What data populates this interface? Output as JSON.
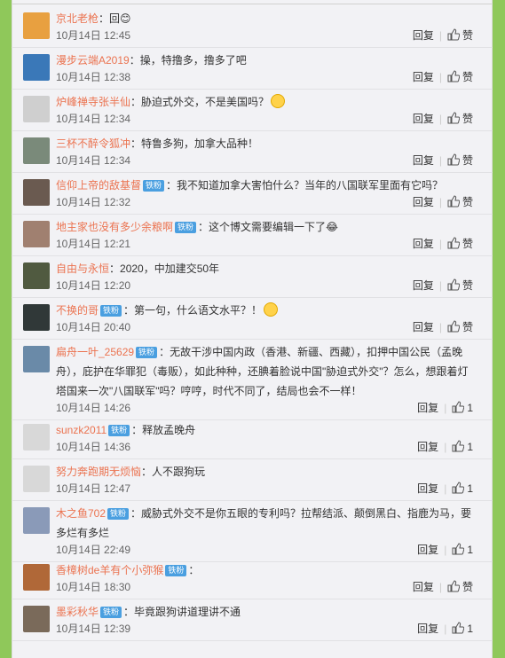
{
  "labels": {
    "reply": "回复",
    "like": "赞"
  },
  "comments": [
    {
      "user": "京北老枪",
      "badge": "",
      "text": "：回😊",
      "date": "10月14日 12:45",
      "likes": "",
      "avatar_color": "#e8a040"
    },
    {
      "user": "漫步云端A2019",
      "badge": "",
      "text": "：操，特撸多，撸多了吧",
      "date": "10月14日 12:38",
      "likes": "",
      "avatar_color": "#3a78b8"
    },
    {
      "user": "炉峰禅寺张半仙",
      "badge": "",
      "text": "：胁迫式外交，不是美国吗？",
      "date": "10月14日 12:34",
      "likes": "",
      "avatar_color": "#cfcfcf"
    },
    {
      "user": "三杯不醉令狐冲",
      "badge": "",
      "text": "：特鲁多狗，加拿大品种！",
      "date": "10月14日 12:34",
      "likes": "",
      "avatar_color": "#7a8a7a"
    },
    {
      "user": "信仰上帝的敌基督",
      "badge": "铁粉",
      "text": "：我不知道加拿大害怕什么？当年的八国联军里面有它吗？",
      "date": "10月14日 12:32",
      "likes": "",
      "avatar_color": "#6a5a50"
    },
    {
      "user": "地主家也没有多少余粮啊",
      "badge": "铁粉",
      "text": "：这个博文需要编辑一下了😂",
      "date": "10月14日 12:21",
      "likes": "",
      "avatar_color": "#a08070"
    },
    {
      "user": "自由与永恒",
      "badge": "",
      "text": "：2020，中加建交50年",
      "date": "10月14日 12:20",
      "likes": "",
      "avatar_color": "#505a40"
    },
    {
      "user": "不换的哥",
      "badge": "铁粉",
      "text": "：第一句，什么语文水平？！",
      "date": "10月14日 20:40",
      "likes": "",
      "avatar_color": "#303838"
    },
    {
      "user": "扁舟一叶_25629",
      "badge": "铁粉",
      "text": "：无故干涉中国内政（香港、新疆、西藏），扣押中国公民（孟晚舟），庇护在华罪犯（毒贩），如此种种，还腆着脸说中国\"胁迫式外交\"？怎么，想跟着灯塔国来一次\"八国联军\"吗？哼哼，时代不同了，结局也会不一样！",
      "date": "10月14日 14:26",
      "likes": "1",
      "avatar_color": "#6a8aa8"
    },
    {
      "user": "sunzk2011",
      "badge": "铁粉",
      "text": "：释放孟晚舟",
      "date": "10月14日 14:36",
      "likes": "1",
      "avatar_color": "#d8d8d8"
    },
    {
      "user": "努力奔跑期无烦恼",
      "badge": "",
      "text": "：人不跟狗玩",
      "date": "10月14日 12:47",
      "likes": "1",
      "avatar_color": "#d8d8d8"
    },
    {
      "user": "木之鱼702",
      "badge": "铁粉",
      "text": "：威胁式外交不是你五眼的专利吗？拉帮结派、颠倒黑白、指鹿为马，要多烂有多烂",
      "date": "10月14日 22:49",
      "likes": "1",
      "avatar_color": "#8a9ab8"
    },
    {
      "user": "香樟树de羊有个小弥猴",
      "badge": "铁粉",
      "text": "：",
      "date": "10月14日 18:30",
      "likes": "",
      "avatar_color": "#b06838"
    },
    {
      "user": "墨彩秋华",
      "badge": "铁粉",
      "text": "：毕竟跟狗讲道理讲不通",
      "date": "10月14日 12:39",
      "likes": "1",
      "avatar_color": "#7a6a5a"
    }
  ]
}
